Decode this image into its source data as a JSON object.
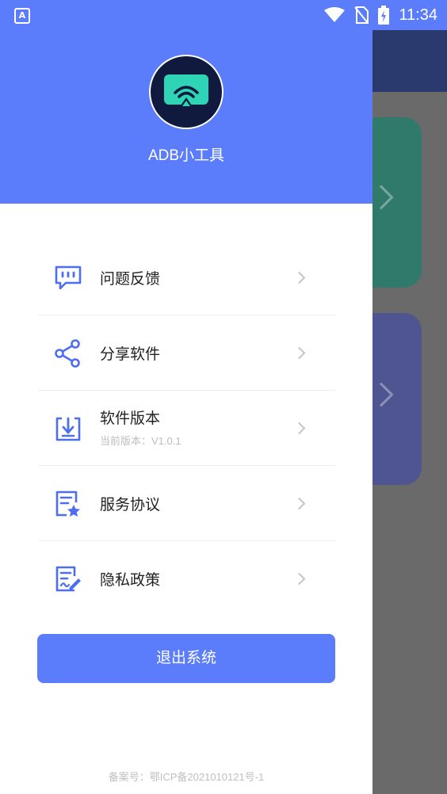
{
  "status_bar": {
    "time": "11:34",
    "notification_icon": "app-notification-icon",
    "notification_letter": "A",
    "icons": [
      "wifi-icon",
      "no-sim-icon",
      "battery-charging-icon"
    ]
  },
  "drawer": {
    "app_name": "ADB小工具",
    "avatar_icon": "cast-screen-icon",
    "menu": [
      {
        "label": "问题反馈",
        "icon": "feedback-icon"
      },
      {
        "label": "分享软件",
        "icon": "share-icon"
      },
      {
        "label": "软件版本",
        "sub": "当前版本：V1.0.1",
        "icon": "download-version-icon"
      },
      {
        "label": "服务协议",
        "icon": "agreement-icon"
      },
      {
        "label": "隐私政策",
        "icon": "privacy-policy-icon"
      }
    ],
    "logout_label": "退出系统",
    "icp": "备案号：鄂ICP备2021010121号-1"
  },
  "colors": {
    "accent": "#5b7dfb",
    "avatar_bg": "#0f1a3e",
    "avatar_icon": "#2fd3b5",
    "icon_stroke": "#4e6ef2"
  }
}
